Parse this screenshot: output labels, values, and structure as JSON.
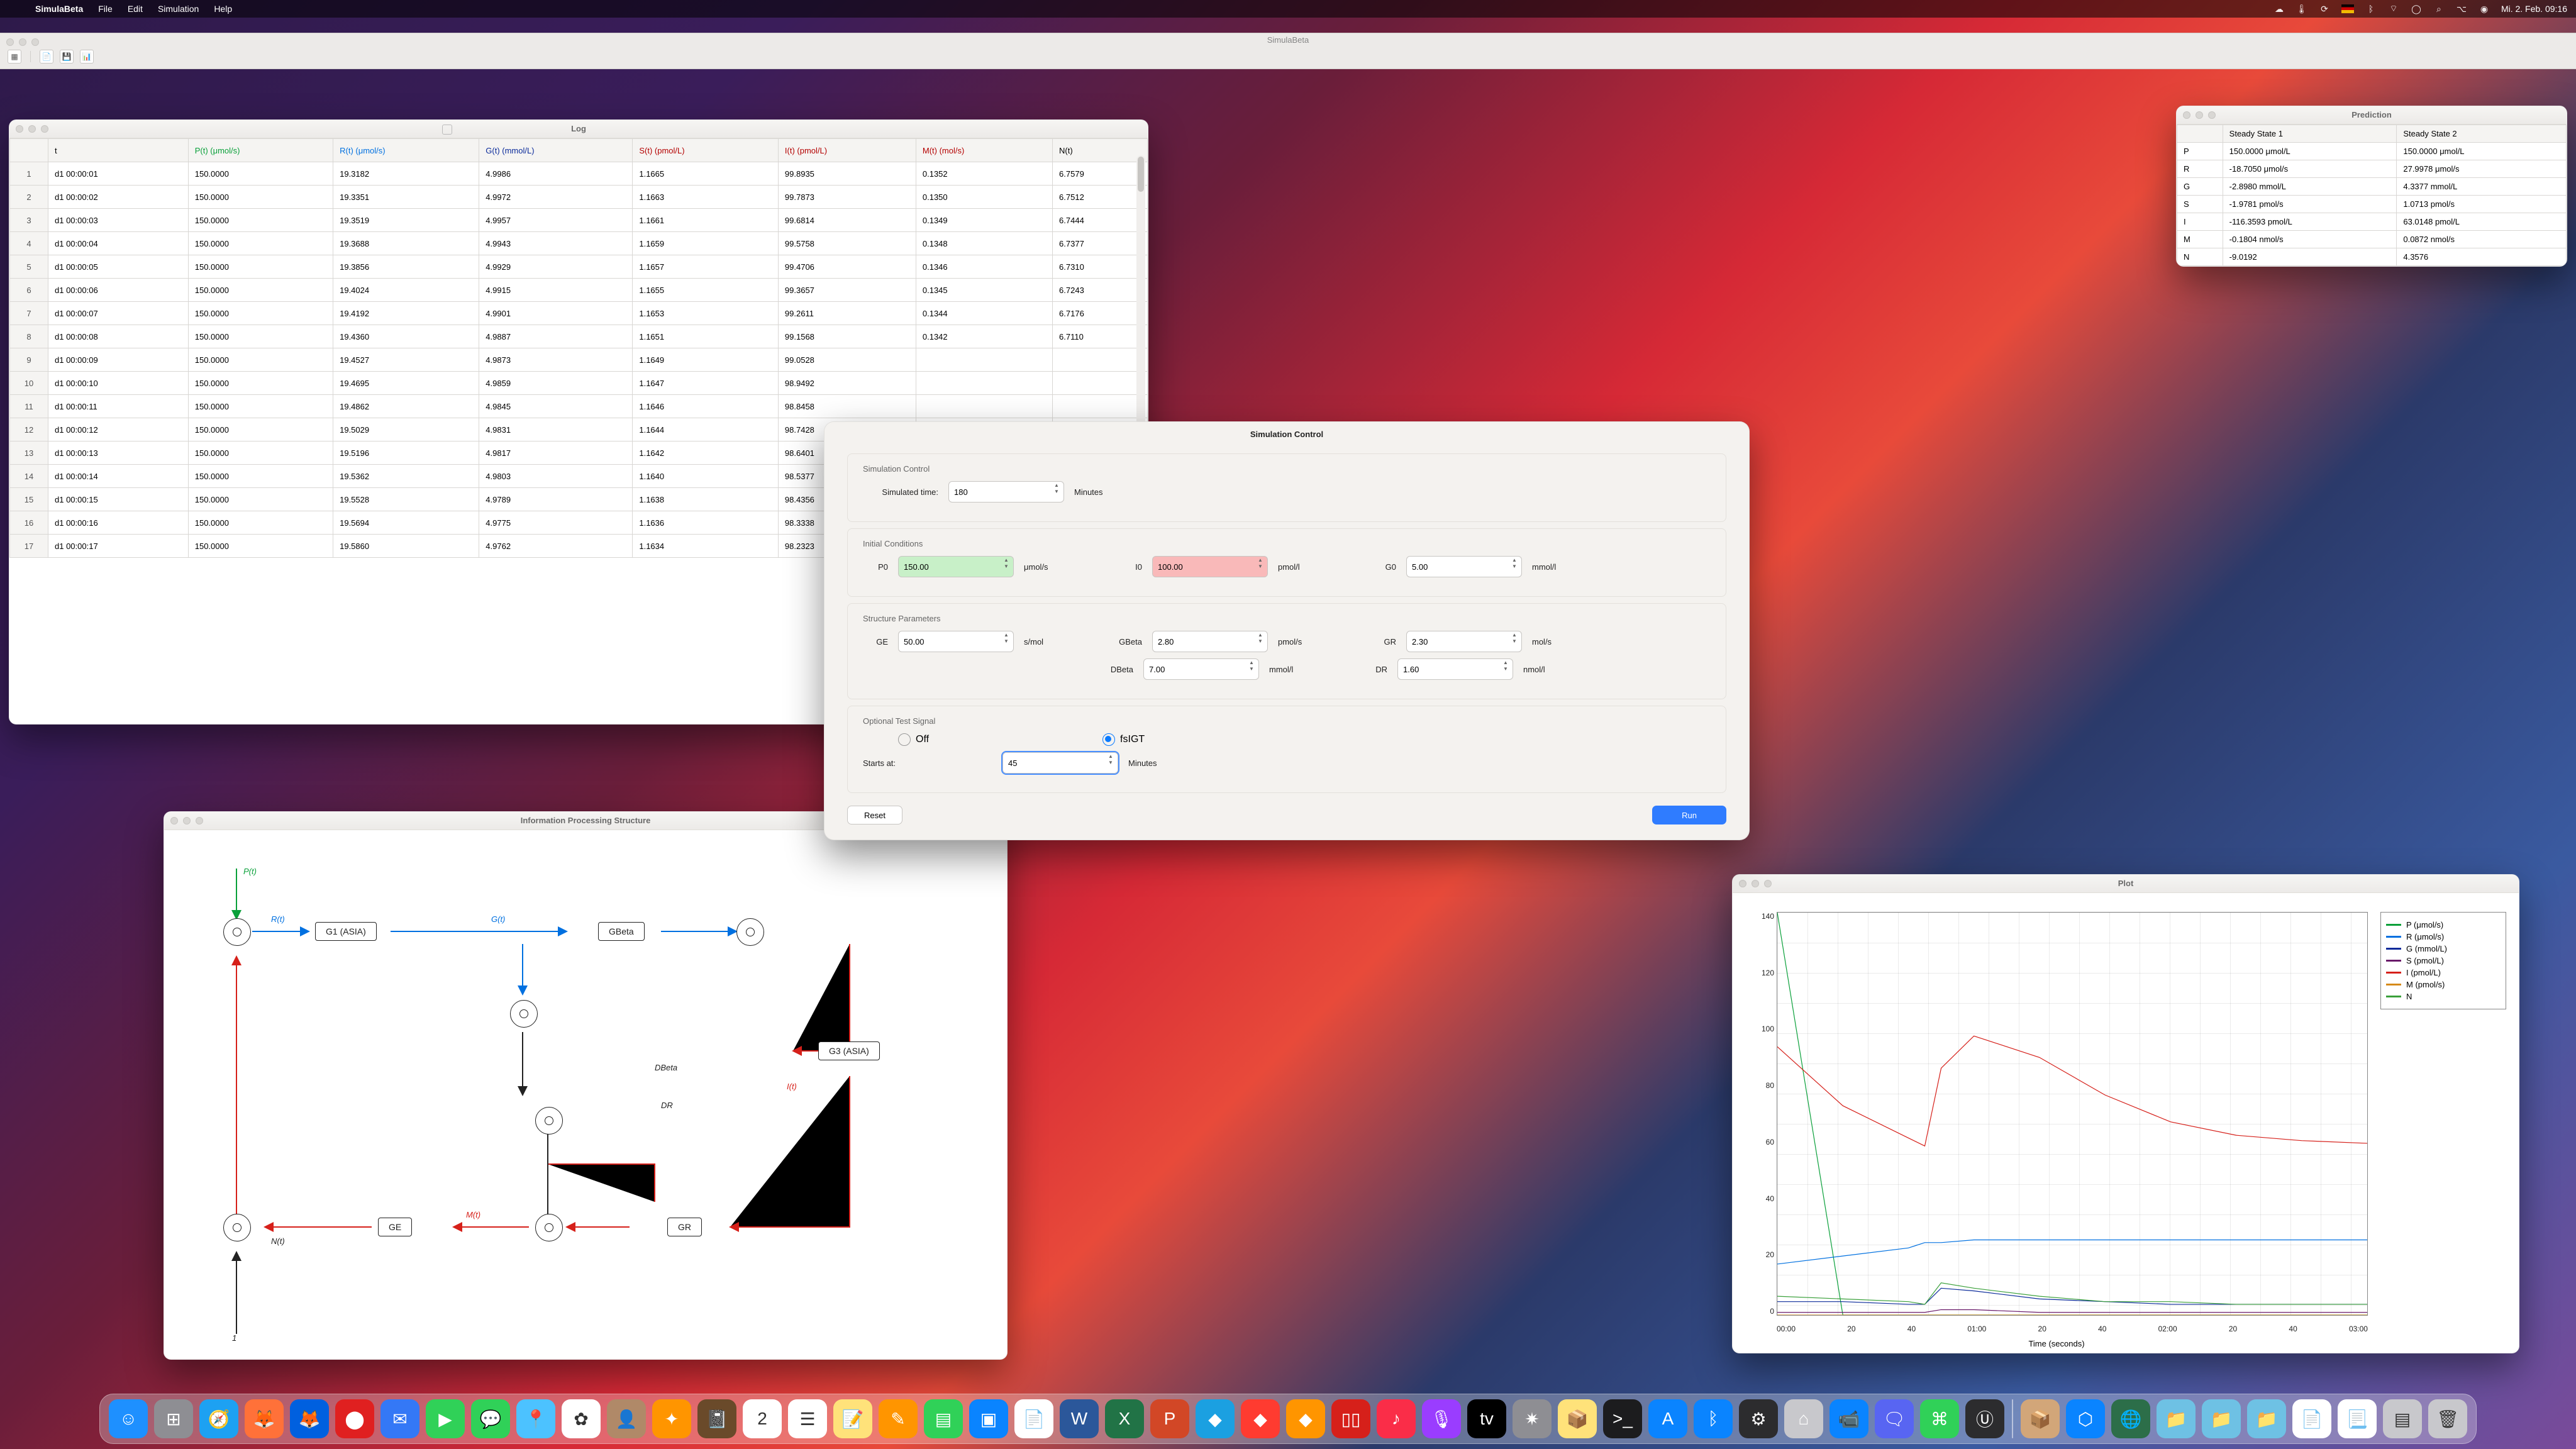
{
  "menubar": {
    "apple": "",
    "app": "SimulaBeta",
    "items": [
      "File",
      "Edit",
      "Simulation",
      "Help"
    ],
    "clock": "Mi. 2. Feb.  09:16"
  },
  "mainwin": {
    "title": "SimulaBeta"
  },
  "toolbar": {
    "new": "▦",
    "open": "📄",
    "save": "💾",
    "chart": "📊"
  },
  "log": {
    "title": "Log",
    "headers": {
      "idx": "",
      "t": "t",
      "P": "P(t) (μmol/s)",
      "R": "R(t) (μmol/s)",
      "G": "G(t) (mmol/L)",
      "S": "S(t) (pmol/L)",
      "I": "I(t) (pmol/L)",
      "M": "M(t) (mol/s)",
      "N": "N(t)"
    },
    "rows": [
      {
        "i": "1",
        "t": "d1 00:00:01",
        "P": "150.0000",
        "R": "19.3182",
        "G": "4.9986",
        "S": "1.1665",
        "I": "99.8935",
        "M": "0.1352",
        "N": "6.7579"
      },
      {
        "i": "2",
        "t": "d1 00:00:02",
        "P": "150.0000",
        "R": "19.3351",
        "G": "4.9972",
        "S": "1.1663",
        "I": "99.7873",
        "M": "0.1350",
        "N": "6.7512"
      },
      {
        "i": "3",
        "t": "d1 00:00:03",
        "P": "150.0000",
        "R": "19.3519",
        "G": "4.9957",
        "S": "1.1661",
        "I": "99.6814",
        "M": "0.1349",
        "N": "6.7444"
      },
      {
        "i": "4",
        "t": "d1 00:00:04",
        "P": "150.0000",
        "R": "19.3688",
        "G": "4.9943",
        "S": "1.1659",
        "I": "99.5758",
        "M": "0.1348",
        "N": "6.7377"
      },
      {
        "i": "5",
        "t": "d1 00:00:05",
        "P": "150.0000",
        "R": "19.3856",
        "G": "4.9929",
        "S": "1.1657",
        "I": "99.4706",
        "M": "0.1346",
        "N": "6.7310"
      },
      {
        "i": "6",
        "t": "d1 00:00:06",
        "P": "150.0000",
        "R": "19.4024",
        "G": "4.9915",
        "S": "1.1655",
        "I": "99.3657",
        "M": "0.1345",
        "N": "6.7243"
      },
      {
        "i": "7",
        "t": "d1 00:00:07",
        "P": "150.0000",
        "R": "19.4192",
        "G": "4.9901",
        "S": "1.1653",
        "I": "99.2611",
        "M": "0.1344",
        "N": "6.7176"
      },
      {
        "i": "8",
        "t": "d1 00:00:08",
        "P": "150.0000",
        "R": "19.4360",
        "G": "4.9887",
        "S": "1.1651",
        "I": "99.1568",
        "M": "0.1342",
        "N": "6.7110"
      },
      {
        "i": "9",
        "t": "d1 00:00:09",
        "P": "150.0000",
        "R": "19.4527",
        "G": "4.9873",
        "S": "1.1649",
        "I": "99.0528",
        "M": "",
        "N": ""
      },
      {
        "i": "10",
        "t": "d1 00:00:10",
        "P": "150.0000",
        "R": "19.4695",
        "G": "4.9859",
        "S": "1.1647",
        "I": "98.9492",
        "M": "",
        "N": ""
      },
      {
        "i": "11",
        "t": "d1 00:00:11",
        "P": "150.0000",
        "R": "19.4862",
        "G": "4.9845",
        "S": "1.1646",
        "I": "98.8458",
        "M": "",
        "N": ""
      },
      {
        "i": "12",
        "t": "d1 00:00:12",
        "P": "150.0000",
        "R": "19.5029",
        "G": "4.9831",
        "S": "1.1644",
        "I": "98.7428",
        "M": "",
        "N": ""
      },
      {
        "i": "13",
        "t": "d1 00:00:13",
        "P": "150.0000",
        "R": "19.5196",
        "G": "4.9817",
        "S": "1.1642",
        "I": "98.6401",
        "M": "",
        "N": ""
      },
      {
        "i": "14",
        "t": "d1 00:00:14",
        "P": "150.0000",
        "R": "19.5362",
        "G": "4.9803",
        "S": "1.1640",
        "I": "98.5377",
        "M": "",
        "N": ""
      },
      {
        "i": "15",
        "t": "d1 00:00:15",
        "P": "150.0000",
        "R": "19.5528",
        "G": "4.9789",
        "S": "1.1638",
        "I": "98.4356",
        "M": "",
        "N": ""
      },
      {
        "i": "16",
        "t": "d1 00:00:16",
        "P": "150.0000",
        "R": "19.5694",
        "G": "4.9775",
        "S": "1.1636",
        "I": "98.3338",
        "M": "",
        "N": ""
      },
      {
        "i": "17",
        "t": "d1 00:00:17",
        "P": "150.0000",
        "R": "19.5860",
        "G": "4.9762",
        "S": "1.1634",
        "I": "98.2323",
        "M": "",
        "N": ""
      }
    ]
  },
  "prediction": {
    "title": "Prediction",
    "headers": {
      "blank": "",
      "s1": "Steady State 1",
      "s2": "Steady State 2"
    },
    "rows": [
      {
        "k": "P",
        "s1": "150.0000 μmol/L",
        "s2": "150.0000 μmol/L"
      },
      {
        "k": "R",
        "s1": "-18.7050 μmol/s",
        "s2": "27.9978 μmol/s"
      },
      {
        "k": "G",
        "s1": "-2.8980 mmol/L",
        "s2": "4.3377 mmol/L"
      },
      {
        "k": "S",
        "s1": "-1.9781 pmol/s",
        "s2": "1.0713 pmol/s"
      },
      {
        "k": "I",
        "s1": "-116.3593 pmol/L",
        "s2": "63.0148 pmol/L"
      },
      {
        "k": "M",
        "s1": "-0.1804 nmol/s",
        "s2": "0.0872 nmol/s"
      },
      {
        "k": "N",
        "s1": "-9.0192",
        "s2": "4.3576"
      }
    ]
  },
  "ips": {
    "title": "Information Processing Structure",
    "labels": {
      "Pt": "P(t)",
      "Rt": "R(t)",
      "Gt": "G(t)",
      "It": "I(t)",
      "Mt": "M(t)",
      "Nt": "N(t)",
      "DBeta": "DBeta",
      "DR": "DR",
      "one": "1"
    },
    "nodes": {
      "G1": "G1 (ASIA)",
      "GBeta": "GBeta",
      "G3": "G3 (ASIA)",
      "GE": "GE",
      "GR": "GR"
    }
  },
  "plot": {
    "title": "Plot",
    "xlabel": "Time (seconds)",
    "yticks": [
      "140",
      "120",
      "100",
      "80",
      "60",
      "40",
      "20",
      "0"
    ],
    "xticks": [
      "00:00",
      "20",
      "40",
      "01:00",
      "20",
      "40",
      "02:00",
      "20",
      "40",
      "03:00"
    ],
    "legend": [
      {
        "name": "P (μmol/s)",
        "color": "#0aa03a"
      },
      {
        "name": "R (μmol/s)",
        "color": "#0070e0"
      },
      {
        "name": "G (mmol/L)",
        "color": "#0a2a9a"
      },
      {
        "name": "S (pmol/L)",
        "color": "#6a1a6a"
      },
      {
        "name": "I (pmol/L)",
        "color": "#d6201a"
      },
      {
        "name": "M (pmol/s)",
        "color": "#d68a1a"
      },
      {
        "name": "N",
        "color": "#3aa03a"
      }
    ]
  },
  "chart_data": {
    "type": "line",
    "xlabel": "Time (seconds)",
    "ylabel": "",
    "ylim": [
      0,
      150
    ],
    "x": [
      0,
      20,
      40,
      45,
      50,
      60,
      80,
      100,
      120,
      140,
      160,
      180
    ],
    "series": [
      {
        "name": "P (μmol/s)",
        "color": "#0aa03a",
        "values": [
          150,
          0,
          0,
          0,
          0,
          0,
          0,
          0,
          0,
          0,
          0,
          0
        ],
        "note": "drops immediately then zero"
      },
      {
        "name": "R (μmol/s)",
        "color": "#0070e0",
        "values": [
          19,
          22,
          25,
          27,
          27,
          28,
          28,
          28,
          28,
          28,
          28,
          28
        ]
      },
      {
        "name": "G (mmol/L)",
        "color": "#0a2a9a",
        "values": [
          5,
          5,
          4,
          4,
          10,
          9,
          6,
          5,
          4,
          4,
          4,
          4
        ]
      },
      {
        "name": "S (pmol/L)",
        "color": "#6a1a6a",
        "values": [
          1,
          1,
          1,
          1,
          2,
          2,
          1,
          1,
          1,
          1,
          1,
          1
        ]
      },
      {
        "name": "I (pmol/L)",
        "color": "#d6201a",
        "values": [
          100,
          78,
          66,
          63,
          92,
          104,
          96,
          82,
          72,
          67,
          65,
          64
        ]
      },
      {
        "name": "M (pmol/s)",
        "color": "#d68a1a",
        "values": [
          0,
          0,
          0,
          0,
          0,
          0,
          0,
          0,
          0,
          0,
          0,
          0
        ]
      },
      {
        "name": "N",
        "color": "#3aa03a",
        "values": [
          7,
          6,
          5,
          4,
          12,
          10,
          7,
          5,
          5,
          4,
          4,
          4
        ]
      }
    ]
  },
  "sim": {
    "title": "Simulation Control",
    "sections": {
      "control": "Simulation Control",
      "initial": "Initial Conditions",
      "struct": "Structure Parameters",
      "test": "Optional Test Signal"
    },
    "labels": {
      "simtime": "Simulated time:",
      "minutes": "Minutes",
      "P0": "P0",
      "I0": "I0",
      "G0": "G0",
      "GE": "GE",
      "GBeta": "GBeta",
      "GR": "GR",
      "DBeta": "DBeta",
      "DR": "DR",
      "off": "Off",
      "fsigt": "fsIGT",
      "starts": "Starts at:",
      "reset": "Reset",
      "run": "Run"
    },
    "values": {
      "simtime": "180",
      "P0": "150.00",
      "I0": "100.00",
      "G0": "5.00",
      "GE": "50.00",
      "GBeta": "2.80",
      "GR": "2.30",
      "DBeta": "7.00",
      "DR": "1.60",
      "starts": "45"
    },
    "units": {
      "P0": "μmol/s",
      "I0": "pmol/l",
      "G0": "mmol/l",
      "GE": "s/mol",
      "GBeta": "pmol/s",
      "GR": "mol/s",
      "DBeta": "mmol/l",
      "DR": "nmol/l"
    },
    "test_selected": "fsIGT"
  },
  "dock": [
    {
      "name": "finder",
      "bg": "#1e90ff",
      "glyph": "☺"
    },
    {
      "name": "launchpad",
      "bg": "#8e8e93",
      "glyph": "⊞"
    },
    {
      "name": "safari",
      "bg": "#1da1f2",
      "glyph": "🧭"
    },
    {
      "name": "firefox",
      "bg": "#ff7139",
      "glyph": "🦊"
    },
    {
      "name": "firefox-dev",
      "bg": "#0060df",
      "glyph": "🦊"
    },
    {
      "name": "record",
      "bg": "#e02020",
      "glyph": "⬤"
    },
    {
      "name": "mail",
      "bg": "#3478f6",
      "glyph": "✉"
    },
    {
      "name": "facetime",
      "bg": "#30d158",
      "glyph": "▶"
    },
    {
      "name": "messages",
      "bg": "#30d158",
      "glyph": "💬"
    },
    {
      "name": "maps",
      "bg": "#4cc2ff",
      "glyph": "📍"
    },
    {
      "name": "photos",
      "bg": "#ffffff",
      "glyph": "✿"
    },
    {
      "name": "contacts",
      "bg": "#b08968",
      "glyph": "👤"
    },
    {
      "name": "app1",
      "bg": "#ff9500",
      "glyph": "✦"
    },
    {
      "name": "app2",
      "bg": "#6a4a2a",
      "glyph": "📓"
    },
    {
      "name": "calendar",
      "bg": "#ffffff",
      "glyph": "2"
    },
    {
      "name": "reminders",
      "bg": "#ffffff",
      "glyph": "☰"
    },
    {
      "name": "notes",
      "bg": "#ffe27a",
      "glyph": "📝"
    },
    {
      "name": "freeform",
      "bg": "#ff9500",
      "glyph": "✎"
    },
    {
      "name": "numbers",
      "bg": "#30d158",
      "glyph": "▤"
    },
    {
      "name": "keynote",
      "bg": "#0a84ff",
      "glyph": "▣"
    },
    {
      "name": "pages",
      "bg": "#ffffff",
      "glyph": "📄"
    },
    {
      "name": "word",
      "bg": "#2b579a",
      "glyph": "W"
    },
    {
      "name": "excel",
      "bg": "#217346",
      "glyph": "X"
    },
    {
      "name": "powerpoint",
      "bg": "#d24726",
      "glyph": "P"
    },
    {
      "name": "affinity1",
      "bg": "#1ba0e1",
      "glyph": "◆"
    },
    {
      "name": "affinity2",
      "bg": "#ff3b30",
      "glyph": "◆"
    },
    {
      "name": "affinity3",
      "bg": "#ff9500",
      "glyph": "◆"
    },
    {
      "name": "parallels",
      "bg": "#d6201a",
      "glyph": "▯▯"
    },
    {
      "name": "music",
      "bg": "#fa2d48",
      "glyph": "♪"
    },
    {
      "name": "podcasts",
      "bg": "#9a3dff",
      "glyph": "🎙"
    },
    {
      "name": "tv",
      "bg": "#000000",
      "glyph": "tv"
    },
    {
      "name": "app3",
      "bg": "#8e8e93",
      "glyph": "✷"
    },
    {
      "name": "app4",
      "bg": "#ffe27a",
      "glyph": "📦"
    },
    {
      "name": "terminal",
      "bg": "#1c1c1e",
      "glyph": ">_"
    },
    {
      "name": "appstore",
      "bg": "#0a84ff",
      "glyph": "A"
    },
    {
      "name": "bluetooth",
      "bg": "#0a84ff",
      "glyph": "ᛒ"
    },
    {
      "name": "app5",
      "bg": "#2c2c2e",
      "glyph": "⚙"
    },
    {
      "name": "app6",
      "bg": "#c8c8cc",
      "glyph": "⌂"
    },
    {
      "name": "zoom",
      "bg": "#0a84ff",
      "glyph": "📹"
    },
    {
      "name": "discord",
      "bg": "#5865f2",
      "glyph": "🗨"
    },
    {
      "name": "app7",
      "bg": "#30d158",
      "glyph": "⌘"
    },
    {
      "name": "app8",
      "bg": "#2c2c2e",
      "glyph": "Ⓤ"
    }
  ],
  "dock_right": [
    {
      "name": "box",
      "bg": "#d2a679",
      "glyph": "📦"
    },
    {
      "name": "simulabeta",
      "bg": "#0a84ff",
      "glyph": "⬡"
    },
    {
      "name": "globe",
      "bg": "#2c6e49",
      "glyph": "🌐"
    },
    {
      "name": "folder1",
      "bg": "#6ec1e4",
      "glyph": "📁"
    },
    {
      "name": "folder2",
      "bg": "#6ec1e4",
      "glyph": "📁"
    },
    {
      "name": "folder3",
      "bg": "#6ec1e4",
      "glyph": "📁"
    },
    {
      "name": "textedit",
      "bg": "#ffffff",
      "glyph": "📄"
    },
    {
      "name": "doc2",
      "bg": "#ffffff",
      "glyph": "📃"
    },
    {
      "name": "doc3",
      "bg": "#c8c8cc",
      "glyph": "▤"
    },
    {
      "name": "trash",
      "bg": "#c8c8cc",
      "glyph": "🗑"
    }
  ]
}
